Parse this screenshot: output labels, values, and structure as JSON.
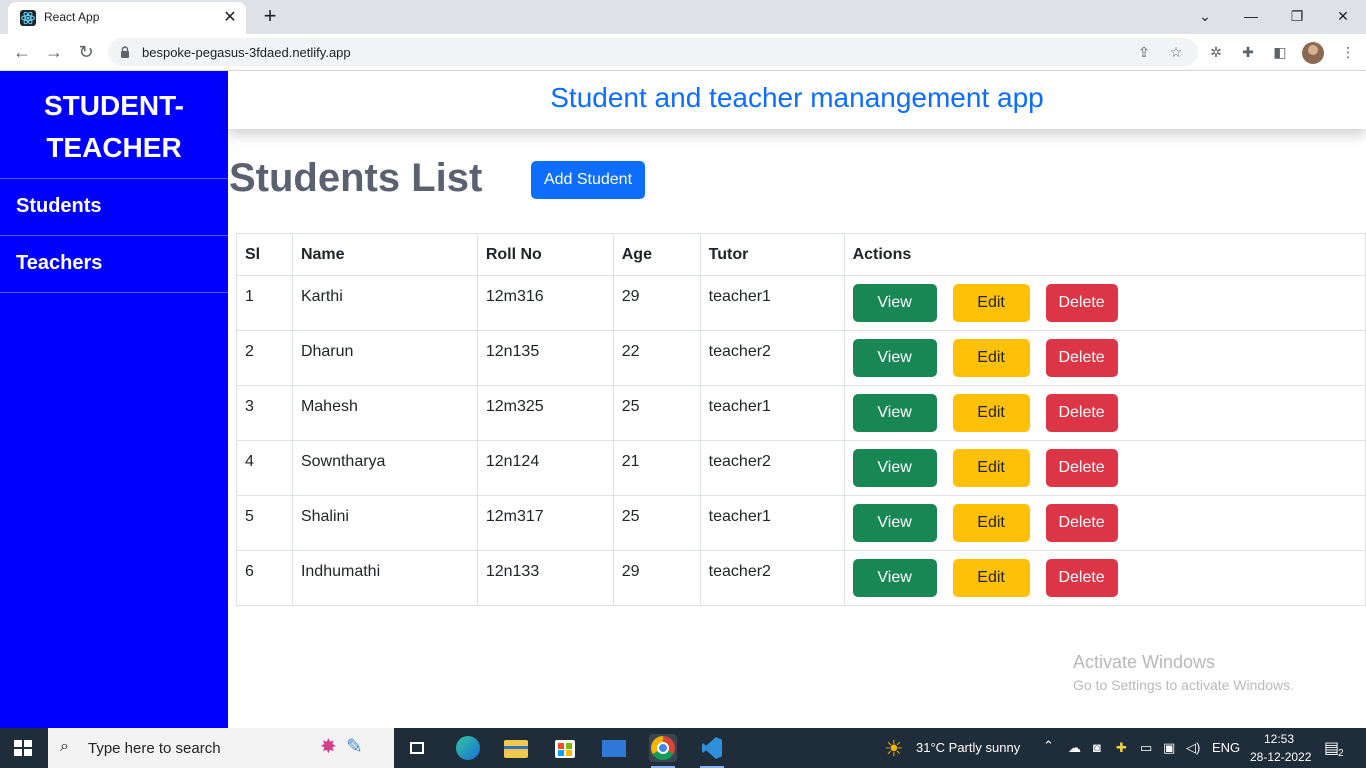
{
  "browser": {
    "tab_title": "React App",
    "tab_close": "✕",
    "new_tab": "+",
    "url": "bespoke-pegasus-3fdaed.netlify.app",
    "window_controls": {
      "dropdown": "⌄",
      "minimize": "—",
      "restore": "❐",
      "close": "✕"
    }
  },
  "sidebar": {
    "brand_line1": "STUDENT-",
    "brand_line2": "TEACHER",
    "items": [
      {
        "label": "Students"
      },
      {
        "label": "Teachers"
      }
    ]
  },
  "header": {
    "title": "Student and teacher manangement app"
  },
  "main": {
    "title": "Students List",
    "add_button": "Add Student",
    "columns": [
      "Sl",
      "Name",
      "Roll No",
      "Age",
      "Tutor",
      "Actions"
    ],
    "rows": [
      {
        "sl": "1",
        "name": "Karthi",
        "roll": "12m316",
        "age": "29",
        "tutor": "teacher1"
      },
      {
        "sl": "2",
        "name": "Dharun",
        "roll": "12n135",
        "age": "22",
        "tutor": "teacher2"
      },
      {
        "sl": "3",
        "name": "Mahesh",
        "roll": "12m325",
        "age": "25",
        "tutor": "teacher1"
      },
      {
        "sl": "4",
        "name": "Sowntharya",
        "roll": "12n124",
        "age": "21",
        "tutor": "teacher2"
      },
      {
        "sl": "5",
        "name": "Shalini",
        "roll": "12m317",
        "age": "25",
        "tutor": "teacher1"
      },
      {
        "sl": "6",
        "name": "Indhumathi",
        "roll": "12n133",
        "age": "29",
        "tutor": "teacher2"
      }
    ],
    "actions": {
      "view": "View",
      "edit": "Edit",
      "delete": "Delete"
    }
  },
  "watermark": {
    "line1": "Activate Windows",
    "line2": "Go to Settings to activate Windows."
  },
  "taskbar": {
    "search_placeholder": "Type here to search",
    "weather": "31°C  Partly sunny",
    "language": "ENG",
    "time": "12:53",
    "date": "28-12-2022",
    "notifications": "2"
  },
  "colors": {
    "sidebar": "#0000ff",
    "primary": "#0d6efd",
    "view": "#198754",
    "edit": "#ffc107",
    "delete": "#dc3545"
  }
}
